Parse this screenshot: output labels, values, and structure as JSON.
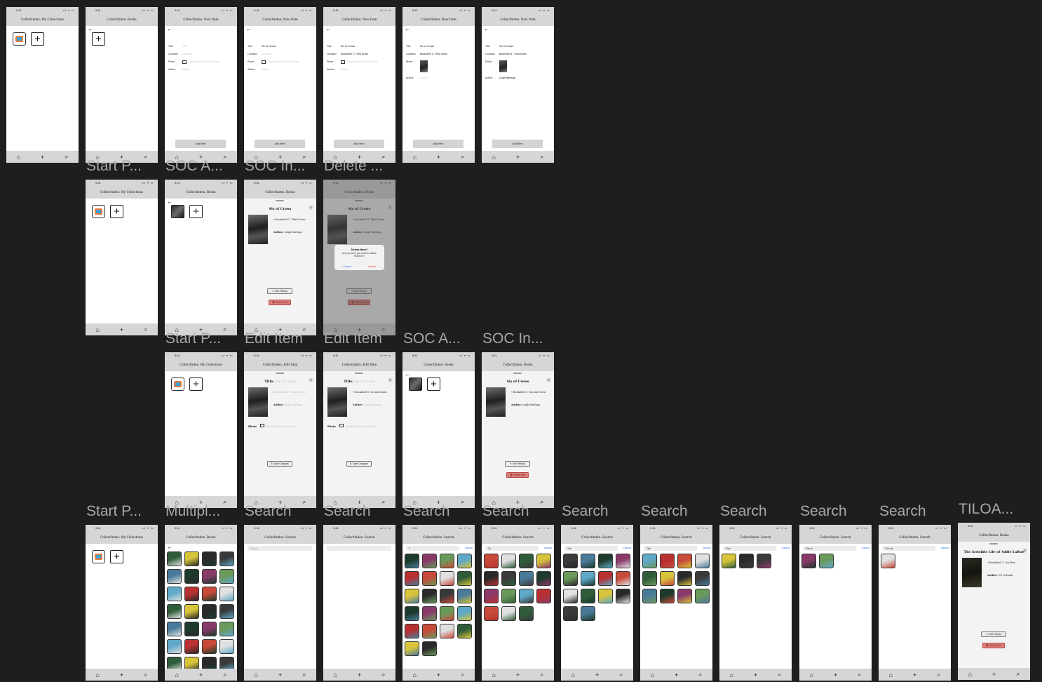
{
  "labels": {
    "row2": [
      "Start P...",
      "SOC A...",
      "SOC In...",
      "Delete ..."
    ],
    "row3": [
      "Start P...",
      "Edit Item",
      "Edit Item",
      "SOC A...",
      "SOC In..."
    ],
    "row4": [
      "Start P...",
      "Multipl...",
      "Search",
      "Search",
      "Search",
      "Search",
      "Search",
      "Search",
      "Search",
      "Search",
      "Search",
      "TILOA..."
    ]
  },
  "status": {
    "time": "9:41",
    "bars": "ııl ᯤ ▭"
  },
  "titles": {
    "my_collections": "CollectIndex: My Collections",
    "books": "CollectIndex: Books",
    "new_item": "CollectIndex: New Item",
    "edit_item": "CollectIndex: Edit Item",
    "search": "CollectIndex: Search"
  },
  "tabbar": {
    "home": "⌂",
    "add": "+",
    "search": "⌕"
  },
  "form": {
    "title_label": "Title",
    "location_label": "Location",
    "photo_label": "Photo",
    "author_label": "Author",
    "title_ph": "Title",
    "location_ph": "Location",
    "photo_ph": "Upload Media From Device",
    "author_ph": "Author",
    "title_val": "Six of Crows",
    "location_val": "Bookshelf 1: Third Down",
    "author_val": "Leigh Bardugo",
    "add_button": "Add Item"
  },
  "sheet": {
    "book_title": "Six of Crows",
    "location": "Bookshelf 1: Third Down",
    "location2": "Bookshelf 1: Second Down",
    "author_label": "Author:",
    "author": "Leigh Bardugo",
    "edit_button": "✎ Edit Field(s)",
    "delete_button": "🗑 Delete Item",
    "close": "X",
    "title_label": "Title:",
    "photo_label": "Photo",
    "photo_ph": "Upload Media From Device",
    "save_button": "⎘ Save Changes"
  },
  "alert": {
    "title": "Delete Item?",
    "body": "Are you sure you want to delete this item?",
    "cancel": "Cancel",
    "delete": "Delete"
  },
  "search": {
    "placeholder": "Search",
    "cancel": "Cancel",
    "q1": "T",
    "q2": "Th",
    "q3": "The",
    "q4": "The ",
    "q5": "The I",
    "q6": "The In",
    "q7": "The Inv"
  },
  "addie": {
    "title": "The Invisible Life of Addie LaRue",
    "location": "Bookshelf 2: Top Row",
    "author_label": "Author:",
    "author": "V.E. Schwab"
  },
  "colors": {
    "background": "#1e1e1e",
    "header": "#d6d6d6",
    "delete": "#d9807c",
    "accent": "#2a6fe0"
  }
}
